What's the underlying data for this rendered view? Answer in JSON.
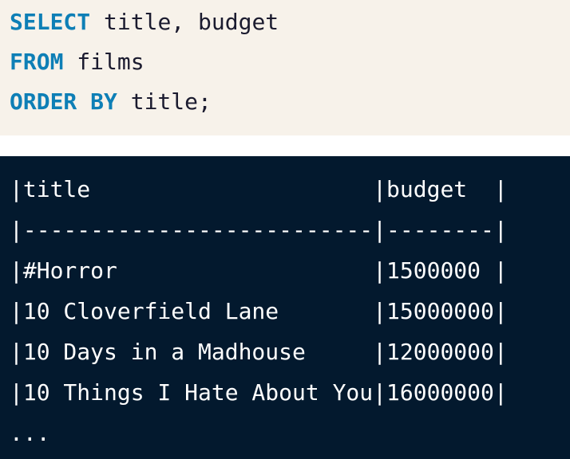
{
  "query": {
    "lines": [
      {
        "keyword": "SELECT",
        "rest": " title, budget"
      },
      {
        "keyword": "FROM",
        "rest": " films"
      },
      {
        "keyword": "ORDER BY",
        "rest": " title;"
      }
    ]
  },
  "results": {
    "lines": [
      "|title                     |budget  |",
      "|--------------------------|--------|",
      "|#Horror                   |1500000 |",
      "|10 Cloverfield Lane       |15000000|",
      "|10 Days in a Madhouse     |12000000|",
      "|10 Things I Hate About You|16000000|",
      "..."
    ]
  },
  "colors": {
    "query_background": "#f7f2ea",
    "keyword": "#0e7fb6",
    "result_background": "#03192e",
    "result_text": "#ffffff"
  }
}
